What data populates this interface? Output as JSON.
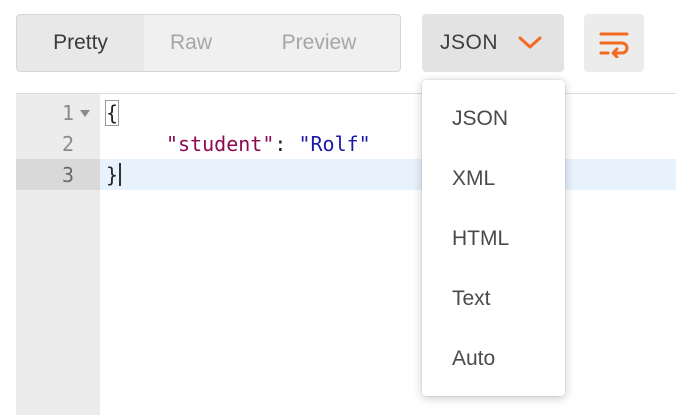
{
  "view_tabs": [
    {
      "label": "Pretty",
      "active": true
    },
    {
      "label": "Raw",
      "active": false
    },
    {
      "label": "Preview",
      "active": false
    }
  ],
  "format": {
    "selected": "JSON",
    "options": [
      "JSON",
      "XML",
      "HTML",
      "Text",
      "Auto"
    ],
    "accent_color": "#f26b21"
  },
  "toolbar": {
    "wrap_icon": "wrap-lines-icon",
    "chevron_icon": "chevron-down-icon"
  },
  "editor": {
    "active_line": 3,
    "lines": [
      {
        "number": "1",
        "brace": "{"
      },
      {
        "number": "2",
        "key": "\"student\"",
        "colon": ": ",
        "value": "\"Rolf\""
      },
      {
        "number": "3",
        "brace": "}"
      }
    ],
    "colors": {
      "key": "#8b0a50",
      "string": "#1a1aa6",
      "active_line": "#e8f2fc"
    }
  }
}
